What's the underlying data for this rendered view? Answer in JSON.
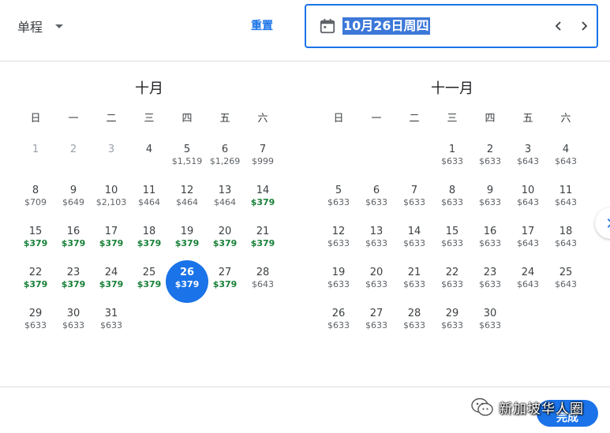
{
  "header": {
    "trip_type": "单程",
    "reset_label": "重置",
    "selected_date_text": "10月26日周四"
  },
  "weekdays": [
    "日",
    "一",
    "二",
    "三",
    "四",
    "五",
    "六"
  ],
  "months": [
    {
      "title": "十月",
      "first_weekday": 0,
      "days": [
        {
          "d": "1",
          "p": "",
          "disabled": true
        },
        {
          "d": "2",
          "p": "",
          "disabled": true
        },
        {
          "d": "3",
          "p": "",
          "disabled": true
        },
        {
          "d": "4",
          "p": ""
        },
        {
          "d": "5",
          "p": "$1,519"
        },
        {
          "d": "6",
          "p": "$1,269"
        },
        {
          "d": "7",
          "p": "$999"
        },
        {
          "d": "8",
          "p": "$709"
        },
        {
          "d": "9",
          "p": "$649"
        },
        {
          "d": "10",
          "p": "$2,103"
        },
        {
          "d": "11",
          "p": "$464"
        },
        {
          "d": "12",
          "p": "$464"
        },
        {
          "d": "13",
          "p": "$464"
        },
        {
          "d": "14",
          "p": "$379",
          "cheap": true
        },
        {
          "d": "15",
          "p": "$379",
          "cheap": true
        },
        {
          "d": "16",
          "p": "$379",
          "cheap": true
        },
        {
          "d": "17",
          "p": "$379",
          "cheap": true
        },
        {
          "d": "18",
          "p": "$379",
          "cheap": true
        },
        {
          "d": "19",
          "p": "$379",
          "cheap": true
        },
        {
          "d": "20",
          "p": "$379",
          "cheap": true
        },
        {
          "d": "21",
          "p": "$379",
          "cheap": true
        },
        {
          "d": "22",
          "p": "$379",
          "cheap": true
        },
        {
          "d": "23",
          "p": "$379",
          "cheap": true
        },
        {
          "d": "24",
          "p": "$379",
          "cheap": true
        },
        {
          "d": "25",
          "p": "$379",
          "cheap": true
        },
        {
          "d": "26",
          "p": "$379",
          "cheap": true,
          "selected": true
        },
        {
          "d": "27",
          "p": "$379",
          "cheap": true
        },
        {
          "d": "28",
          "p": "$643"
        },
        {
          "d": "29",
          "p": "$633"
        },
        {
          "d": "30",
          "p": "$633"
        },
        {
          "d": "31",
          "p": "$633"
        }
      ]
    },
    {
      "title": "十一月",
      "first_weekday": 3,
      "days": [
        {
          "d": "1",
          "p": "$633"
        },
        {
          "d": "2",
          "p": "$633"
        },
        {
          "d": "3",
          "p": "$643"
        },
        {
          "d": "4",
          "p": "$643"
        },
        {
          "d": "5",
          "p": "$633"
        },
        {
          "d": "6",
          "p": "$633"
        },
        {
          "d": "7",
          "p": "$633"
        },
        {
          "d": "8",
          "p": "$633"
        },
        {
          "d": "9",
          "p": "$633"
        },
        {
          "d": "10",
          "p": "$643"
        },
        {
          "d": "11",
          "p": "$643"
        },
        {
          "d": "12",
          "p": "$633"
        },
        {
          "d": "13",
          "p": "$633"
        },
        {
          "d": "14",
          "p": "$633"
        },
        {
          "d": "15",
          "p": "$633"
        },
        {
          "d": "16",
          "p": "$633"
        },
        {
          "d": "17",
          "p": "$643"
        },
        {
          "d": "18",
          "p": "$643"
        },
        {
          "d": "19",
          "p": "$633"
        },
        {
          "d": "20",
          "p": "$633"
        },
        {
          "d": "21",
          "p": "$633"
        },
        {
          "d": "22",
          "p": "$633"
        },
        {
          "d": "23",
          "p": "$633"
        },
        {
          "d": "24",
          "p": "$643"
        },
        {
          "d": "25",
          "p": "$643"
        },
        {
          "d": "26",
          "p": "$633"
        },
        {
          "d": "27",
          "p": "$633"
        },
        {
          "d": "28",
          "p": "$633"
        },
        {
          "d": "29",
          "p": "$633"
        },
        {
          "d": "30",
          "p": "$633"
        }
      ]
    }
  ],
  "footer": {
    "done_label": "完成",
    "watermark_text": "新加坡华人圈"
  },
  "icons": {
    "trip_caret": "caret-down-icon",
    "date_field": "calendar-icon",
    "prev": "chevron-left-icon",
    "next": "chevron-right-icon",
    "scroll": "chevron-right-icon",
    "watermark": "wechat-logo-icon"
  },
  "colors": {
    "accent": "#1a73e8",
    "cheap_price": "#188038",
    "regular_price": "#5f6368",
    "disabled_day": "#9aa0a6",
    "text_highlight": "#3c78d8",
    "divider": "#dadce0"
  }
}
